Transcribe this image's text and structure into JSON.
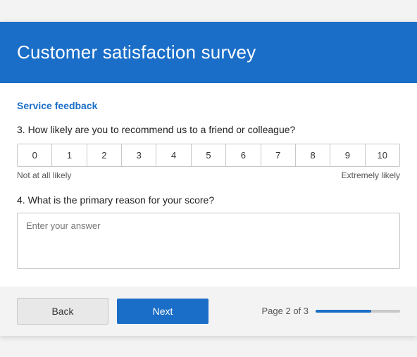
{
  "header": {
    "title": "Customer satisfaction survey"
  },
  "section": {
    "title": "Service feedback"
  },
  "question3": {
    "label": "3. How likely are you to recommend us to a friend or colleague?",
    "scale": [
      "0",
      "1",
      "2",
      "3",
      "4",
      "5",
      "6",
      "7",
      "8",
      "9",
      "10"
    ],
    "label_low": "Not at all likely",
    "label_high": "Extremely likely"
  },
  "question4": {
    "label": "4. What is the primary reason for your score?",
    "placeholder": "Enter your answer"
  },
  "footer": {
    "back_label": "Back",
    "next_label": "Next",
    "page_label": "Page 2 of 3",
    "progress_percent": 66
  }
}
